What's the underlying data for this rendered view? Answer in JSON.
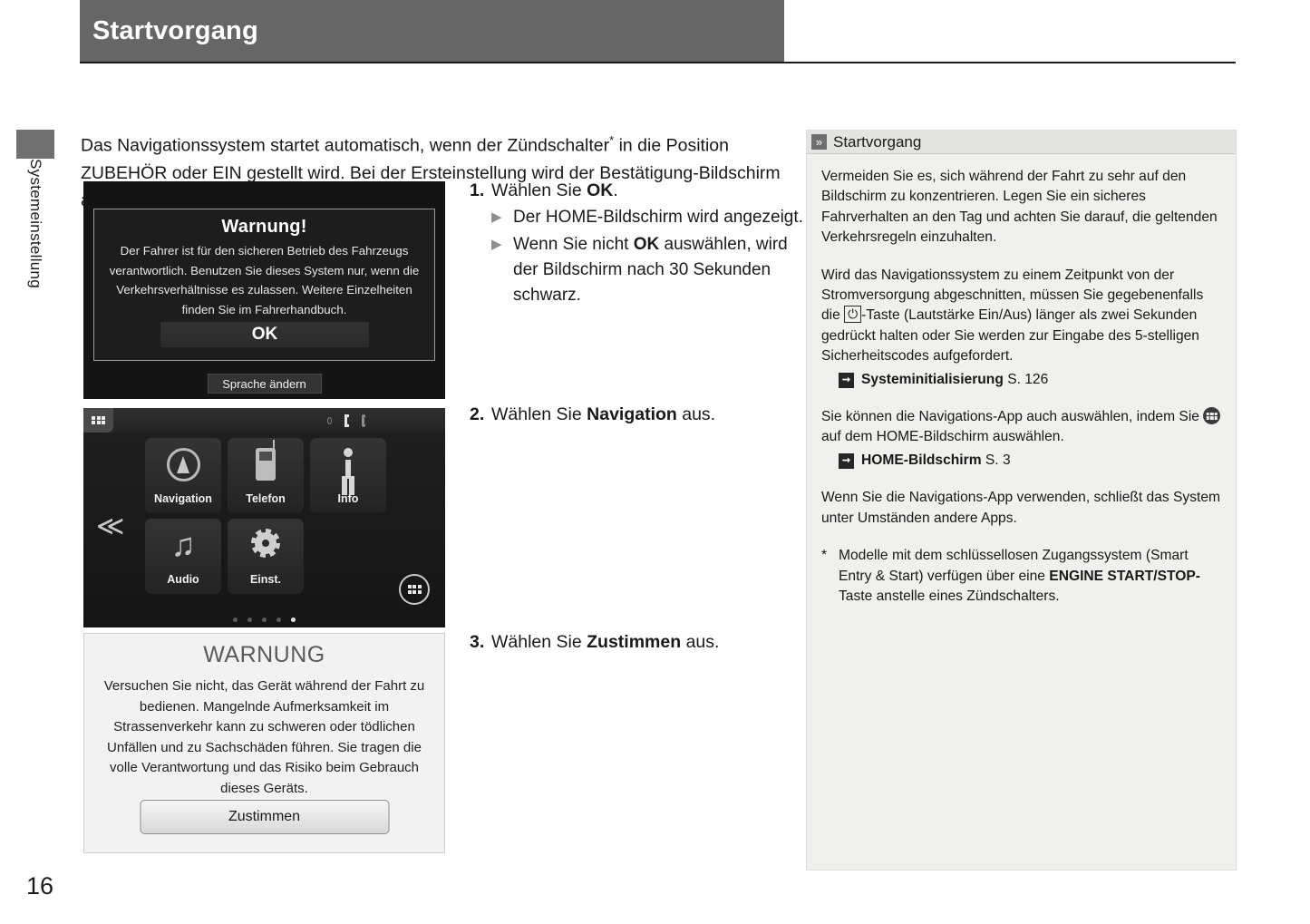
{
  "header": {
    "title": "Startvorgang"
  },
  "side_tab": {
    "label": "Systemeinstellung"
  },
  "page_number": "16",
  "intro": {
    "line1_a": "Das Navigationssystem startet automatisch, wenn der Zündschalter",
    "footnote_mark": "*",
    "line1_b": " in die Position ZUBEHÖR",
    "line2": "oder EIN gestellt wird. Bei der Ersteinstellung wird der Bestätigung-Bildschirm angezeigt."
  },
  "screens": {
    "warning_dialog": {
      "title": "Warnung!",
      "body": "Der Fahrer ist für den sicheren Betrieb des Fahrzeugs verantwortlich. Benutzen Sie dieses System nur, wenn die Verkehrsverhältnisse es zulassen. Weitere Einzelheiten finden Sie im Fahrerhandbuch.",
      "ok_label": "OK",
      "language_label": "Sprache ändern"
    },
    "home_screen": {
      "tiles_row1": [
        {
          "label": "Navigation",
          "icon": "compass-icon"
        },
        {
          "label": "Telefon",
          "icon": "phone-icon"
        },
        {
          "label": "Info",
          "icon": "info-icon"
        }
      ],
      "tiles_row2": [
        {
          "label": "Audio",
          "icon": "music-note-icon"
        },
        {
          "label": "Einst.",
          "icon": "gear-icon"
        }
      ],
      "status_icons": [
        "circle-icon",
        "signal-icon",
        "bluetooth-icon"
      ],
      "apps_grid_icon": "apps-grid-icon",
      "back_chevron_icon": "double-chevron-left-icon",
      "page_dots": {
        "count": 5,
        "active_index": 4
      }
    },
    "agreement": {
      "title": "WARNUNG",
      "body": "Versuchen Sie nicht, das Gerät während der Fahrt zu bedienen. Mangelnde Aufmerksamkeit im Strassenverkehr kann zu schweren oder tödlichen Unfällen und zu Sachschäden führen. Sie tragen die volle Verantwortung und das Risiko beim Gebrauch dieses Geräts.",
      "button_label": "Zustimmen"
    }
  },
  "steps": [
    {
      "num": "1.",
      "text_pre": "Wählen Sie ",
      "text_bold": "OK",
      "text_post": ".",
      "substeps": [
        {
          "pre": "Der HOME-Bildschirm wird angezeigt.",
          "bold": "",
          "post": ""
        },
        {
          "pre": "Wenn Sie nicht ",
          "bold": "OK",
          "post": " auswählen, wird der Bildschirm nach 30 Sekunden schwarz."
        }
      ]
    },
    {
      "num": "2.",
      "text_pre": "Wählen Sie ",
      "text_bold": "Navigation",
      "text_post": " aus.",
      "substeps": []
    },
    {
      "num": "3.",
      "text_pre": "Wählen Sie ",
      "text_bold": "Zustimmen",
      "text_post": " aus.",
      "substeps": []
    }
  ],
  "panel": {
    "head_title": "Startvorgang",
    "head_icon": "double-chevron-right-icon",
    "paragraph1": "Vermeiden Sie es, sich während der Fahrt zu sehr auf den Bildschirm zu konzentrieren. Legen Sie ein sicheres Fahrverhalten an den Tag und achten Sie darauf, die geltenden Verkehrsregeln einzuhalten.",
    "paragraph2_a": "Wird das Navigationssystem zu einem Zeitpunkt von der Stromversorgung abgeschnitten, müssen Sie gegebenenfalls die ",
    "paragraph2_icon": "power-button-icon",
    "paragraph2_b": "-Taste (Lautstärke Ein/Aus) länger als zwei Sekunden gedrückt halten oder Sie werden zur Eingabe des 5-stelligen Sicherheitscodes aufgefordert.",
    "ref1": {
      "icon": "reference-arrow-icon",
      "bold": "Systeminitialisierung",
      "page": " S. 126"
    },
    "paragraph3_a": "Sie können die Navigations-App auch auswählen, indem Sie ",
    "paragraph3_icon": "apps-grid-icon",
    "paragraph3_b": " auf dem HOME-Bildschirm auswählen.",
    "ref2": {
      "icon": "reference-arrow-icon",
      "bold": "HOME-Bildschirm",
      "page": " S. 3"
    },
    "paragraph4": "Wenn Sie die Navigations-App verwenden, schließt das System unter Umständen andere Apps.",
    "footnote_mark": "*",
    "footnote_a": "Modelle mit dem schlüssellosen Zugangssystem (Smart Entry & Start) verfügen über eine ",
    "footnote_bold": "ENGINE START/STOP-",
    "footnote_b": "Taste anstelle eines Zündschalters."
  }
}
